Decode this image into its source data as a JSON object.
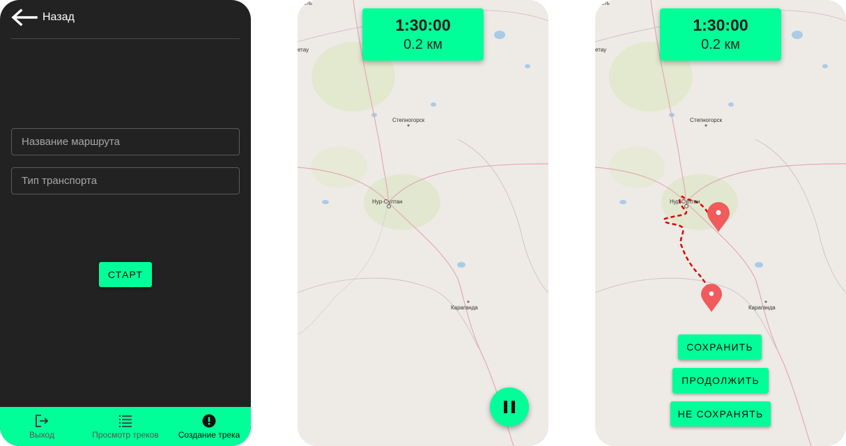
{
  "create_screen": {
    "back_label": "Назад",
    "route_name_placeholder": "Название маршрута",
    "transport_placeholder": "Тип транспорта",
    "start_label": "СТАРТ"
  },
  "bottom_nav": {
    "items": [
      {
        "label": "Выход",
        "icon": "exit-icon"
      },
      {
        "label": "Просмотр треков",
        "icon": "list-icon"
      },
      {
        "label": "Создание трека",
        "icon": "alert-icon",
        "active": true
      }
    ]
  },
  "tracking_screen": {
    "time": "1:30:00",
    "distance": "0.2 км"
  },
  "finish_screen": {
    "time": "1:30:00",
    "distance": "0.2 км",
    "save_label": "СОХРАНИТЬ",
    "continue_label": "ПРОДОЛЖИТЬ",
    "discard_label": "НЕ СОХРАНЯТЬ"
  },
  "map_labels": {
    "oblast": "ласть",
    "city_left": "етау",
    "stepnogorsk": "Степногорск",
    "nursultan": "Нур-Султан",
    "karaganda": "Караганда"
  },
  "colors": {
    "accent": "#00ff99",
    "dark_bg": "#222222",
    "map_bg": "#eeebe6",
    "route": "#e00000",
    "marker": "#f05b5b"
  }
}
